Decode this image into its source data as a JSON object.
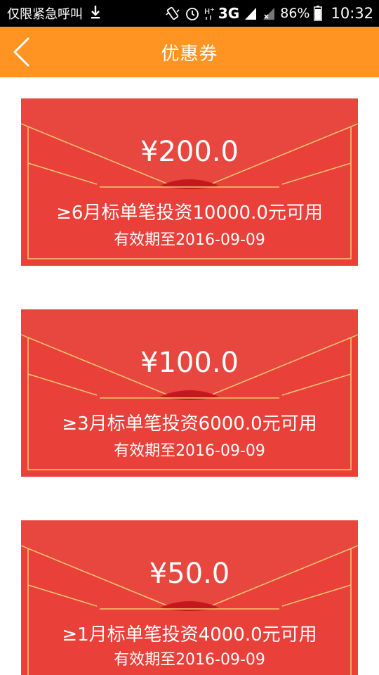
{
  "status_bar": {
    "carrier_text": "仅限紧急呼叫",
    "network": "3G",
    "battery": "86%",
    "time": "10:32"
  },
  "header": {
    "title": "优惠券",
    "bg_color": "#ff9422"
  },
  "coupons": [
    {
      "amount": "¥200.0",
      "condition": "≥6月标单笔投资10000.0元可用",
      "validity": "有效期至2016-09-09"
    },
    {
      "amount": "¥100.0",
      "condition": "≥3月标单笔投资6000.0元可用",
      "validity": "有效期至2016-09-09"
    },
    {
      "amount": "¥50.0",
      "condition": "≥1月标单笔投资4000.0元可用",
      "validity": "有效期至2016-09-09"
    }
  ],
  "colors": {
    "coupon_red": "#e9403a",
    "gold_line": "#f5c870"
  }
}
